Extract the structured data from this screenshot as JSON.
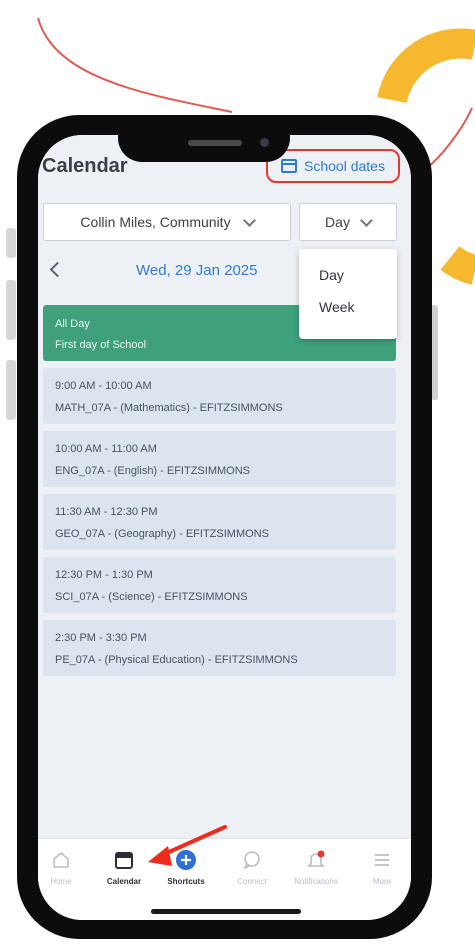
{
  "app": {
    "title": "Calendar",
    "school_dates_label": "School dates"
  },
  "filters": {
    "person_value": "Collin Miles, Community",
    "view_value": "Day",
    "view_options": [
      "Day",
      "Week"
    ]
  },
  "date_nav": {
    "current_date": "Wed, 29 Jan 2025"
  },
  "all_day_event": {
    "label": "All Day",
    "title": "First day of School"
  },
  "events": [
    {
      "time": "9:00 AM - 10:00 AM",
      "detail": "MATH_07A - (Mathematics) - EFITZSIMMONS"
    },
    {
      "time": "10:00 AM - 11:00 AM",
      "detail": "ENG_07A - (English) - EFITZSIMMONS"
    },
    {
      "time": "11:30 AM - 12:30 PM",
      "detail": "GEO_07A - (Geography) - EFITZSIMMONS"
    },
    {
      "time": "12:30 PM - 1:30 PM",
      "detail": "SCI_07A - (Science) - EFITZSIMMONS"
    },
    {
      "time": "2:30 PM - 3:30 PM",
      "detail": "PE_07A - (Physical Education) - EFITZSIMMONS"
    }
  ],
  "tabbar": {
    "tabs": [
      {
        "label": "Home",
        "icon": "home-icon"
      },
      {
        "label": "Calendar",
        "icon": "calendar-icon",
        "active": true
      },
      {
        "label": "Shortcuts",
        "icon": "plus-circle-icon"
      },
      {
        "label": "Connect",
        "icon": "chat-bubble-icon"
      },
      {
        "label": "Notifications",
        "icon": "bell-icon",
        "badge": true
      },
      {
        "label": "More",
        "icon": "menu-icon"
      }
    ]
  },
  "colors": {
    "accent_blue": "#2f7bd1",
    "all_day_green": "#3fa07c",
    "event_bg": "#dbe4ef",
    "highlight_red": "#e8372c",
    "decor_yellow": "#f5b82e"
  }
}
